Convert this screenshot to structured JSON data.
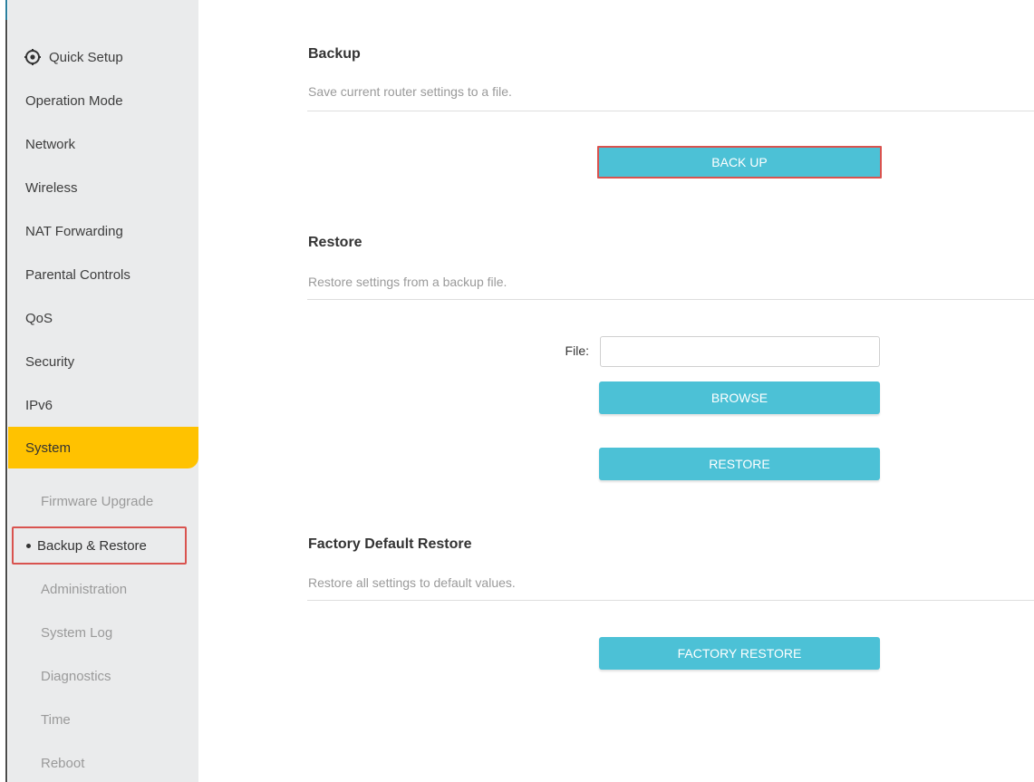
{
  "sidebar": {
    "quick_setup": {
      "label": "Quick Setup",
      "icon": "gear-icon"
    },
    "items": [
      {
        "label": "Operation Mode"
      },
      {
        "label": "Network"
      },
      {
        "label": "Wireless"
      },
      {
        "label": "NAT Forwarding"
      },
      {
        "label": "Parental Controls"
      },
      {
        "label": "QoS"
      },
      {
        "label": "Security"
      },
      {
        "label": "IPv6"
      },
      {
        "label": "System"
      }
    ],
    "active_item": "System",
    "sub_items": [
      {
        "label": "Firmware Upgrade"
      },
      {
        "label": "Backup & Restore"
      },
      {
        "label": "Administration"
      },
      {
        "label": "System Log"
      },
      {
        "label": "Diagnostics"
      },
      {
        "label": "Time"
      },
      {
        "label": "Reboot"
      }
    ],
    "selected_sub_item": "Backup & Restore"
  },
  "backup": {
    "title": "Backup",
    "description": "Save current router settings to a file.",
    "button_label": "BACK UP"
  },
  "restore": {
    "title": "Restore",
    "description": "Restore settings from a backup file.",
    "file_label": "File:",
    "file_value": "",
    "browse_label": "BROWSE",
    "restore_label": "RESTORE"
  },
  "factory": {
    "title": "Factory Default Restore",
    "description": "Restore all settings to default values.",
    "button_label": "FACTORY RESTORE"
  },
  "colors": {
    "accent_button": "#4cc1d6",
    "active_nav": "#ffc200",
    "highlight_border": "#d9534f",
    "sidebar_bg": "#eaebec"
  }
}
